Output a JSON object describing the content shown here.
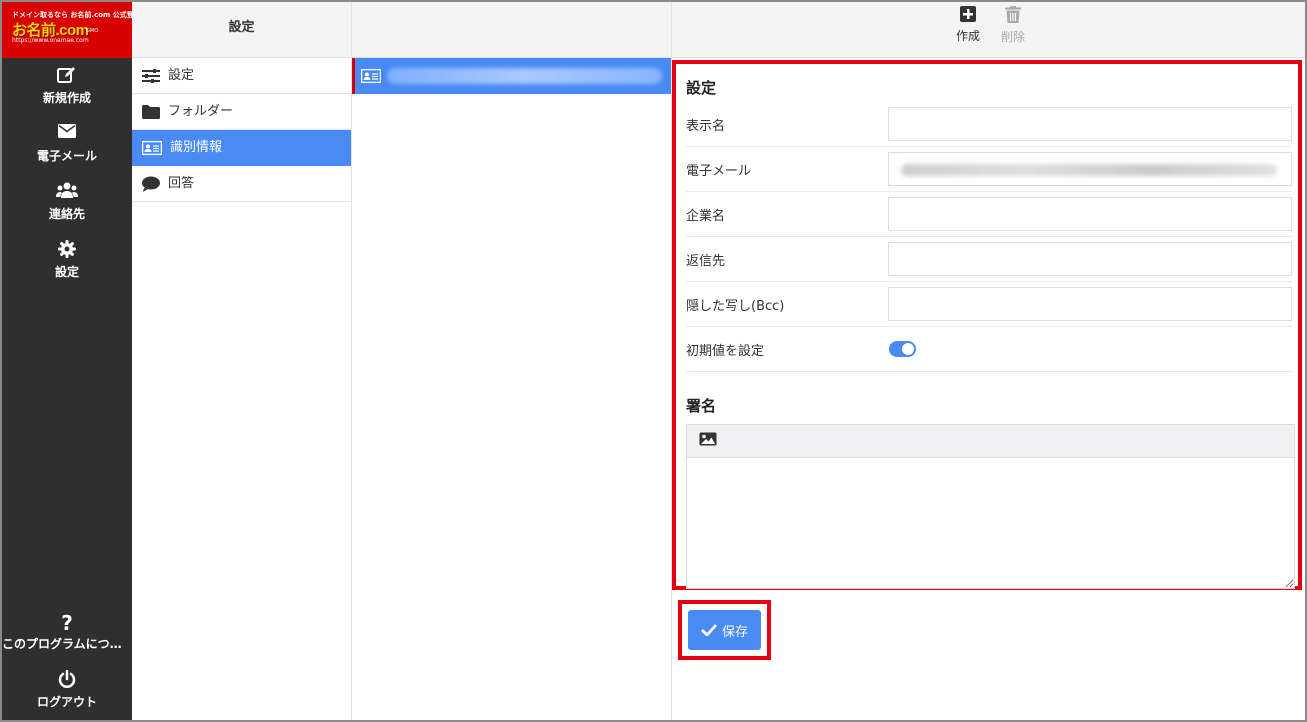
{
  "brand": {
    "tagline": "ドメイン取るなら お名前.com 公式登録サービス",
    "name": "お名前.com",
    "url": "https://www.onamae.com",
    "sub": "GMO"
  },
  "nav": {
    "items": [
      {
        "label": "新規作成",
        "icon": "compose-icon"
      },
      {
        "label": "電子メール",
        "icon": "envelope-icon"
      },
      {
        "label": "連絡先",
        "icon": "contacts-icon"
      },
      {
        "label": "設定",
        "icon": "gear-icon"
      }
    ],
    "about_label": "このプログラムについて",
    "logout_label": "ログアウト"
  },
  "settings_list": {
    "header": "設定",
    "items": [
      {
        "label": "設定",
        "icon": "sliders-icon"
      },
      {
        "label": "フォルダー",
        "icon": "folder-icon"
      },
      {
        "label": "識別情報",
        "icon": "id-card-icon",
        "active": true
      },
      {
        "label": "回答",
        "icon": "chat-bubble-icon"
      }
    ]
  },
  "toolbar": {
    "create_label": "作成",
    "delete_label": "削除"
  },
  "form": {
    "section_title": "設定",
    "fields": {
      "display_name_label": "表示名",
      "email_label": "電子メール",
      "organization_label": "企業名",
      "reply_to_label": "返信先",
      "bcc_label": "隠した写し(Bcc)",
      "default_label": "初期値を設定"
    },
    "default_on": true,
    "signature_title": "署名"
  },
  "save_label": "保存",
  "colors": {
    "accent": "#4a8af4",
    "highlight": "#e60012",
    "nav_bg": "#2f2f2f",
    "brand_red": "#d90000"
  }
}
